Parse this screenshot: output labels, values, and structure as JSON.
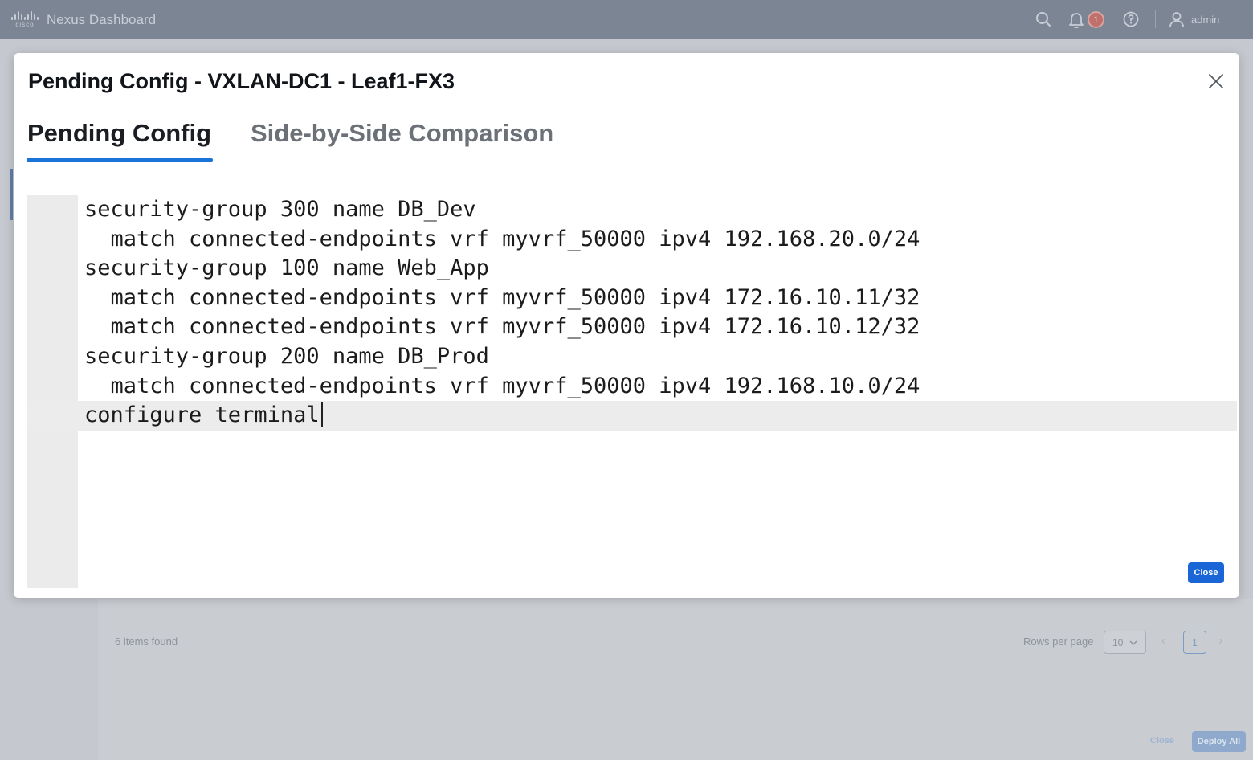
{
  "topbar": {
    "logo_text": "cisco",
    "app_title": "Nexus Dashboard",
    "notification_count": "1",
    "user_name": "admin"
  },
  "background": {
    "items_found": "6 items found",
    "rows_per_page_label": "Rows per page",
    "rows_per_page_value": "10",
    "current_page": "1",
    "close_label": "Close",
    "deploy_all_label": "Deploy All"
  },
  "modal": {
    "title": "Pending Config - VXLAN-DC1 - Leaf1-FX3",
    "tabs": [
      {
        "label": "Pending Config",
        "active": true
      },
      {
        "label": "Side-by-Side Comparison",
        "active": false
      }
    ],
    "code_lines": [
      "security-group 300 name DB_Dev",
      "  match connected-endpoints vrf myvrf_50000 ipv4 192.168.20.0/24",
      "security-group 100 name Web_App",
      "  match connected-endpoints vrf myvrf_50000 ipv4 172.16.10.11/32",
      "  match connected-endpoints vrf myvrf_50000 ipv4 172.16.10.12/32",
      "security-group 200 name DB_Prod",
      "  match connected-endpoints vrf myvrf_50000 ipv4 192.168.10.0/24",
      "configure terminal"
    ],
    "active_line_index": 7,
    "close_button_label": "Close"
  },
  "colors": {
    "accent": "#1a73d8",
    "primary_button": "#1a66d6",
    "topbar_dimmed": "#7b8594"
  },
  "icons": [
    "cisco-logo",
    "search-icon",
    "bell-icon",
    "help-icon",
    "user-icon",
    "close-icon",
    "chevron-down-icon",
    "chevron-left-icon",
    "chevron-right-icon"
  ]
}
